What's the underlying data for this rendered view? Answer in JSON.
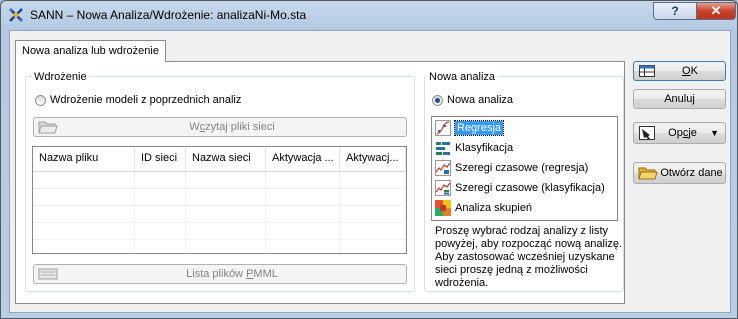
{
  "window": {
    "title": "SANN – Nowa Analiza/Wdrożenie: analizaNi-Mo.sta",
    "help_label": "?",
    "close_label": "✕"
  },
  "tab": {
    "label": "Nowa analiza lub wdrożenie"
  },
  "deployment": {
    "group_label": "Wdrożenie",
    "radio_label": "Wdrożenie modeli z poprzednich analiz",
    "load_button": {
      "pre": "W",
      "key": "c",
      "post": "zytaj pliki sieci"
    },
    "columns": [
      "Nazwa pliku",
      "ID sieci",
      "Nazwa sieci",
      "Aktywacja ...",
      "Aktywacj..."
    ],
    "pmml_button": {
      "pre": "Lista plików ",
      "key": "P",
      "post": "MML"
    }
  },
  "new_analysis": {
    "group_label": "Nowa analiza",
    "radio_label": "Nowa analiza",
    "types": [
      {
        "label": "Regresja",
        "icon": "regression-icon",
        "selected": true
      },
      {
        "label": "Klasyfikacja",
        "icon": "classification-icon",
        "selected": false
      },
      {
        "label": "Szeregi czasowe (regresja)",
        "icon": "time-series-regression-icon",
        "selected": false
      },
      {
        "label": "Szeregi czasowe (klasyfikacja)",
        "icon": "time-series-classification-icon",
        "selected": false
      },
      {
        "label": "Analiza skupień",
        "icon": "cluster-analysis-icon",
        "selected": false
      }
    ],
    "description": "Proszę wybrać rodzaj analizy z listy powyżej, aby rozpocząć nową analizę. Aby zastosować wcześniej uzyskane sieci proszę jedną z możliwości wdrożenia."
  },
  "buttons": {
    "ok": {
      "key": "O",
      "post": "K"
    },
    "cancel": "Anuluj",
    "options": {
      "pre": "Op",
      "key": "c",
      "post": "je"
    },
    "open_data": "Otwórz dane"
  }
}
